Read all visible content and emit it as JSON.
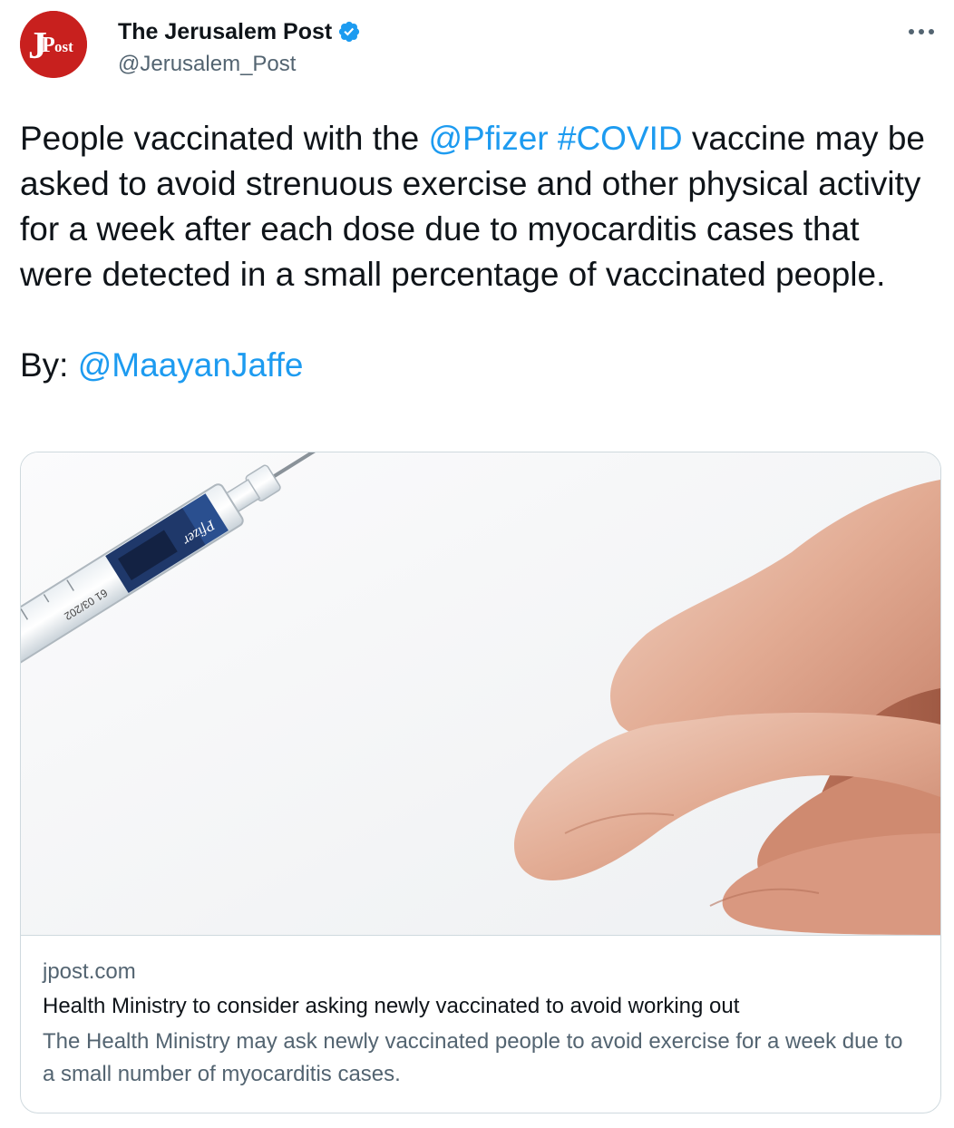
{
  "author": {
    "name": "The Jerusalem Post",
    "handle": "@Jerusalem_Post",
    "avatar_text": "JPost",
    "verified": true
  },
  "tweet": {
    "part1": "People vaccinated with the ",
    "mention_pfizer": "@Pfizer",
    "space1": " ",
    "hashtag_covid": "#COVID",
    "part2": " vaccine may be asked to avoid strenuous exercise and other physical activity for a week after each dose due to myocarditis cases that were detected in a small percentage of vaccinated people.",
    "byline_prefix": "By: ",
    "byline_mention": "@MaayanJaffe"
  },
  "card": {
    "domain": "jpost.com",
    "title": "Health Ministry to consider asking newly vaccinated to avoid working out",
    "description": "The Health Ministry may ask newly vaccinated people to avoid exercise for a week due to a small number of myocarditis cases.",
    "image_label_brand": "Pfizer",
    "image_label_code": "61 03/202"
  },
  "colors": {
    "link": "#1d9bf0",
    "text": "#0f1419",
    "secondary": "#536471",
    "border": "#cfd9de",
    "avatar_bg": "#c8201e",
    "verified": "#1d9bf0"
  },
  "icons": {
    "verified": "verified-badge-icon",
    "more": "more-options-icon"
  }
}
